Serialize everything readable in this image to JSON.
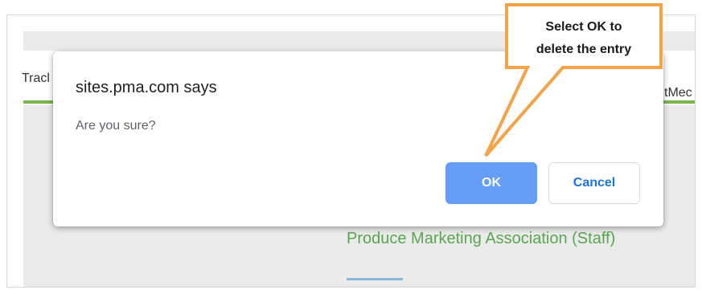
{
  "background": {
    "left_cut_text": "Tracl",
    "right_cut_text": "tMec",
    "org_name": "Produce Marketing Association (Staff)"
  },
  "dialog": {
    "title": "sites.pma.com says",
    "message": "Are you sure?",
    "ok_label": "OK",
    "cancel_label": "Cancel"
  },
  "callout": {
    "line1": "Select OK to",
    "line2": "delete the entry",
    "color": "#f4a347"
  },
  "colors": {
    "ok_button": "#669df6",
    "cancel_text": "#1a73e8",
    "green_rule": "#7ab648",
    "org_text": "#5aa552"
  }
}
